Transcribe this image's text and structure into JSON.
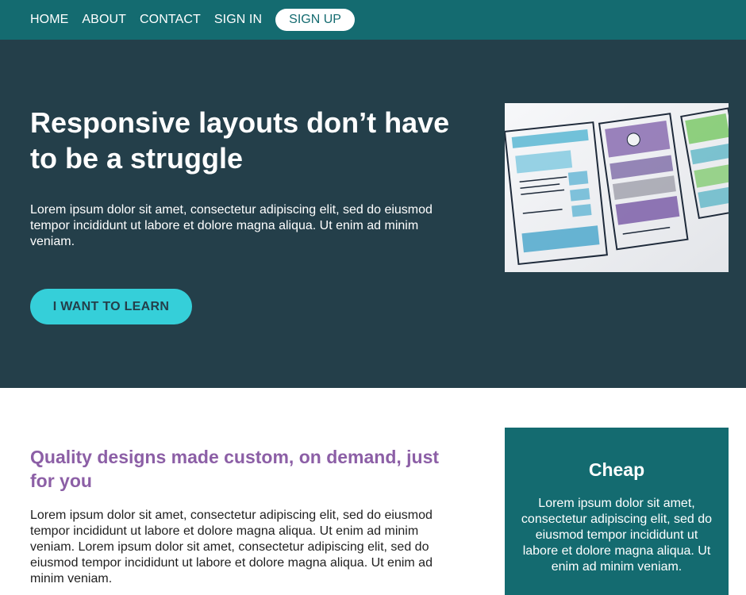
{
  "nav": {
    "items": [
      "HOME",
      "ABOUT",
      "CONTACT",
      "SIGN IN"
    ],
    "signup": "SIGN UP"
  },
  "hero": {
    "title": "Responsive layouts don’t have to be a struggle",
    "text": "Lorem ipsum dolor sit amet, consectetur adipiscing elit, sed do eiusmod tempor incididunt ut labore et dolore magna aliqua. Ut enim ad minim veniam.",
    "button": "I WANT TO LEARN",
    "image_icon": "wireframe-sketch-image"
  },
  "content": {
    "title": "Quality designs made custom, on demand, just for you",
    "text": "Lorem ipsum dolor sit amet, consectetur adipiscing elit, sed do eiusmod tempor incididunt ut labore et dolore magna aliqua. Ut enim ad minim veniam. Lorem ipsum dolor sit amet, consectetur adipiscing elit, sed do eiusmod tempor incididunt ut labore et dolore magna aliqua. Ut enim ad minim veniam."
  },
  "card": {
    "title": "Cheap",
    "text": "Lorem ipsum dolor sit amet, consectetur adipiscing elit, sed do eiusmod tempor incididunt ut labore et dolore magna aliqua. Ut enim ad minim veniam."
  },
  "colors": {
    "nav_bg": "#146b70",
    "hero_bg": "#243f4a",
    "accent_button": "#35cfd9",
    "content_title": "#8c5fa6",
    "card_bg": "#146b70"
  }
}
